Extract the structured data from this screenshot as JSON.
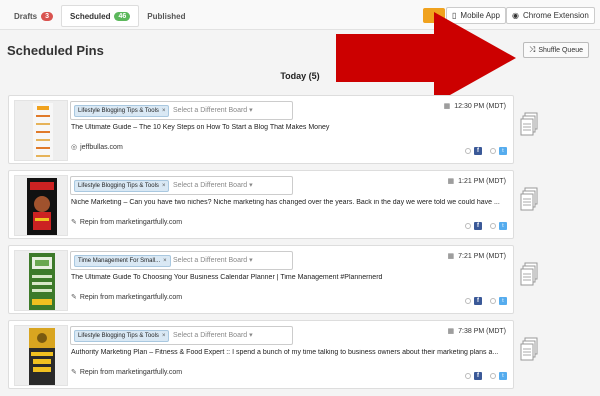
{
  "tabs": [
    {
      "label": "Drafts",
      "count": "3"
    },
    {
      "label": "Scheduled",
      "count": "46"
    },
    {
      "label": "Published"
    }
  ],
  "top_buttons": {
    "mobile_app": "Mobile App",
    "chrome_extension": "Chrome Extension"
  },
  "page": {
    "title": "Scheduled Pins",
    "day_heading": "Today (5)",
    "shuffle_label": "Shuffle Queue"
  },
  "board_placeholder": "Select a Different Board",
  "pins": [
    {
      "board": "Lifestyle Blogging Tips & Tools",
      "time": "12:30 PM (MDT)",
      "description": "The Ultimate Guide – The 10 Key Steps on How To Start a Blog That Makes Money",
      "source": "jeffbullas.com",
      "source_icon": "globe-icon"
    },
    {
      "board": "Lifestyle Blogging Tips & Tools",
      "time": "1:21 PM (MDT)",
      "description": "Niche Marketing – Can you have two niches? Niche marketing has changed over the years. Back in the day we were told we could have ...",
      "source": "Repin from marketingartfully.com",
      "source_icon": "pin-icon"
    },
    {
      "board": "Time Management For Small...",
      "time": "7:21 PM (MDT)",
      "description": "The Ultimate Guide To Choosing Your Business Calendar Planner | Time Management #Plannernerd",
      "source": "Repin from marketingartfully.com",
      "source_icon": "pin-icon"
    },
    {
      "board": "Lifestyle Blogging Tips & Tools",
      "time": "7:38 PM (MDT)",
      "description": "Authority Marketing Plan – Fitness & Food Expert :: I spend a bunch of my time talking to business owners about their marketing plans a...",
      "source": "Repin from marketingartfully.com",
      "source_icon": "pin-icon"
    }
  ],
  "colors": {
    "arrow": "#cc0000",
    "drafts_badge": "#d9534f",
    "scheduled_badge": "#5cb85c",
    "facebook": "#3b5998",
    "twitter": "#55acee"
  }
}
